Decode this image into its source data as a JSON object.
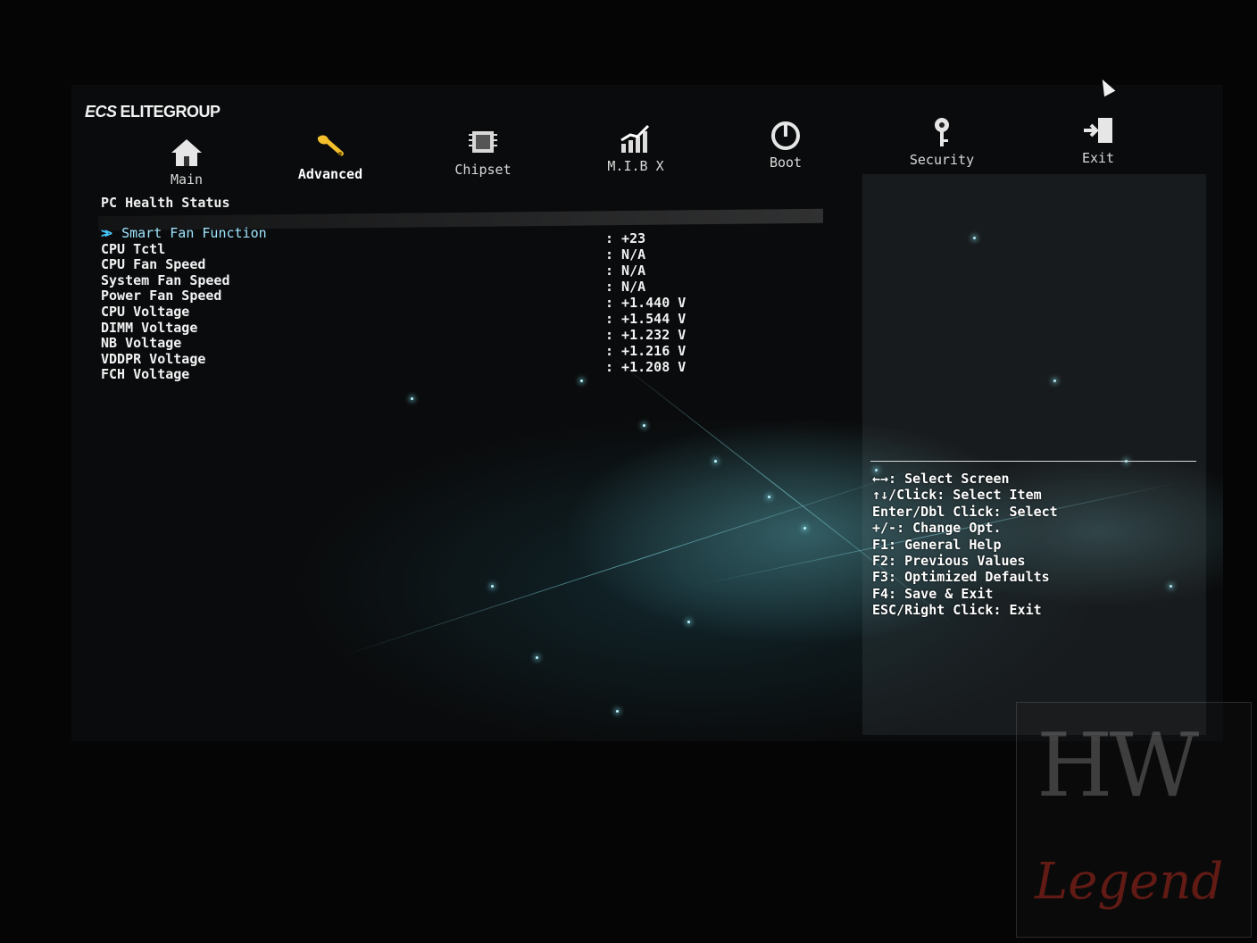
{
  "brand": {
    "mark": "ECS",
    "name": "ELITEGROUP"
  },
  "tabs": [
    {
      "label": "Main",
      "icon": "home-icon"
    },
    {
      "label": "Advanced",
      "icon": "wrench-icon",
      "active": true
    },
    {
      "label": "Chipset",
      "icon": "chip-icon"
    },
    {
      "label": "M.I.B X",
      "icon": "chart-icon"
    },
    {
      "label": "Boot",
      "icon": "power-icon"
    },
    {
      "label": "Security",
      "icon": "key-icon"
    },
    {
      "label": "Exit",
      "icon": "exit-icon"
    }
  ],
  "section_title": "PC Health Status",
  "items": [
    {
      "label": "Smart Fan Function",
      "selected": true
    },
    {
      "label": "CPU Tctl"
    },
    {
      "label": "CPU Fan Speed"
    },
    {
      "label": "System Fan Speed"
    },
    {
      "label": "Power Fan Speed"
    },
    {
      "label": "CPU Voltage"
    },
    {
      "label": "DIMM Voltage"
    },
    {
      "label": "NB Voltage"
    },
    {
      "label": "VDDPR Voltage"
    },
    {
      "label": "FCH Voltage"
    }
  ],
  "values": [
    ": +23",
    ": N/A",
    ": N/A",
    ": N/A",
    ": +1.440 V",
    ": +1.544 V",
    ": +1.232 V",
    ": +1.216 V",
    ": +1.208 V"
  ],
  "help": [
    "←→: Select Screen",
    "↑↓/Click: Select Item",
    "Enter/Dbl Click: Select",
    "+/-: Change Opt.",
    "F1: General Help",
    "F2: Previous Values",
    "F3: Optimized Defaults",
    "F4: Save & Exit",
    "ESC/Right Click: Exit"
  ],
  "watermark": {
    "top": "HW",
    "bottom": "Legend"
  },
  "colors": {
    "highlight": "#9fe6ff",
    "chevron": "#49c8ff",
    "text": "#f2f2f2"
  }
}
